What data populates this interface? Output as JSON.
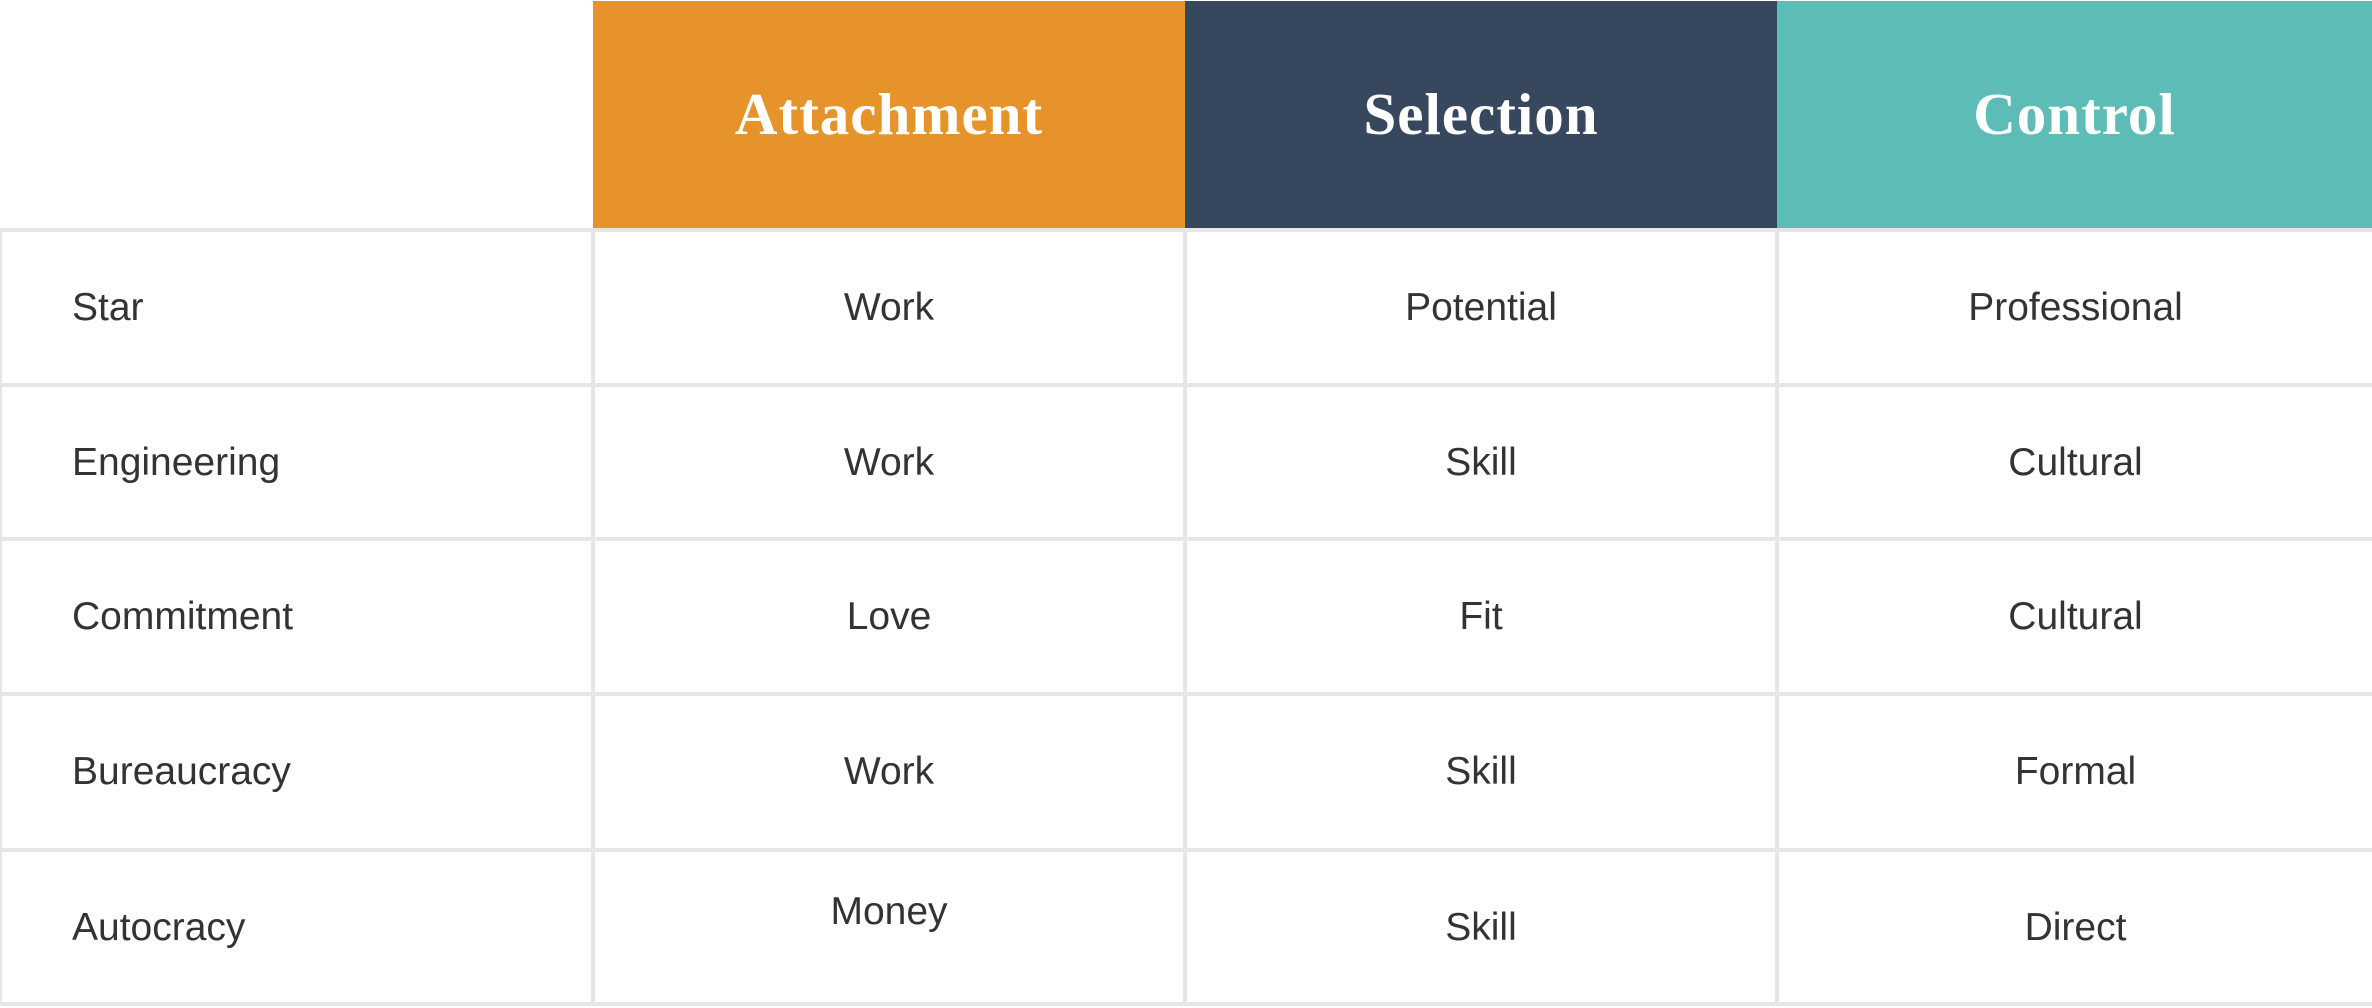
{
  "colors": {
    "attachment": "#E5932A",
    "selection": "#37475E",
    "control": "#5DBDB6",
    "grid": "#E6E6E6",
    "text": "#333333"
  },
  "table": {
    "corner": "",
    "columns": [
      "Attachment",
      "Selection",
      "Control"
    ],
    "rows": [
      {
        "label": "Star",
        "values": [
          "Work",
          "Potential",
          "Professional"
        ]
      },
      {
        "label": "Engineering",
        "values": [
          "Work",
          "Skill",
          "Cultural"
        ]
      },
      {
        "label": "Commitment",
        "values": [
          "Love",
          "Fit",
          "Cultural"
        ]
      },
      {
        "label": "Bureaucracy",
        "values": [
          "Work",
          "Skill",
          "Formal"
        ]
      },
      {
        "label": "Autocracy",
        "values": [
          "Money",
          "Skill",
          "Direct"
        ]
      }
    ]
  }
}
